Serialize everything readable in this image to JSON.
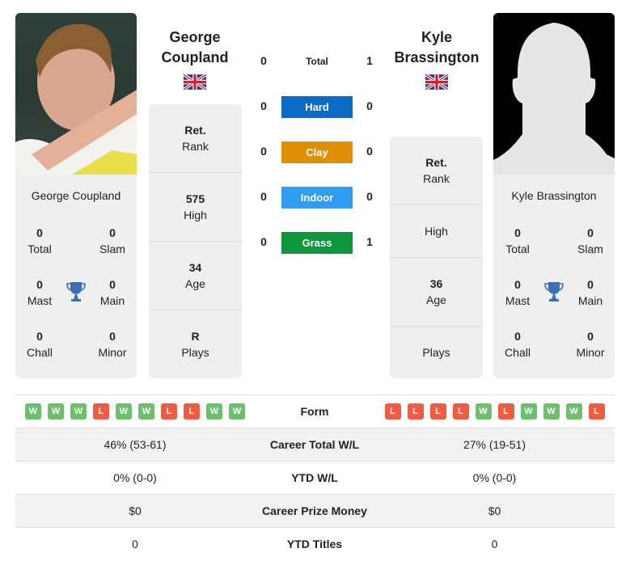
{
  "colors": {
    "hard": "#0a6cc6",
    "clay": "#e08f05",
    "indoor": "#2f9ef2",
    "grass": "#0e973c",
    "win": "#6cbf6c",
    "loss": "#ee5c42",
    "trophy": "#3b6fb6"
  },
  "player1": {
    "name_line1": "George",
    "name_line2": "Coupland",
    "card_name": "George Coupland",
    "flag": "uk-flag",
    "photo": "player-photo",
    "titles": {
      "total": {
        "value": "0",
        "label": "Total"
      },
      "slam": {
        "value": "0",
        "label": "Slam"
      },
      "mast": {
        "value": "0",
        "label": "Mast"
      },
      "main": {
        "value": "0",
        "label": "Main"
      },
      "chall": {
        "value": "0",
        "label": "Chall"
      },
      "minor": {
        "value": "0",
        "label": "Minor"
      }
    },
    "rank": [
      {
        "value": "Ret.",
        "label": "Rank"
      },
      {
        "value": "575",
        "label": "High"
      },
      {
        "value": "34",
        "label": "Age"
      },
      {
        "value": "R",
        "label": "Plays"
      }
    ],
    "form": [
      "W",
      "W",
      "W",
      "L",
      "W",
      "W",
      "L",
      "L",
      "W",
      "W"
    ],
    "career_wl": "46% (53-61)",
    "ytd_wl": "0% (0-0)",
    "prize": "$0",
    "ytd_titles": "0"
  },
  "player2": {
    "name_line1": "Kyle",
    "name_line2": "Brassington",
    "card_name": "Kyle Brassington",
    "flag": "uk-flag",
    "photo": "silhouette-placeholder",
    "titles": {
      "total": {
        "value": "0",
        "label": "Total"
      },
      "slam": {
        "value": "0",
        "label": "Slam"
      },
      "mast": {
        "value": "0",
        "label": "Mast"
      },
      "main": {
        "value": "0",
        "label": "Main"
      },
      "chall": {
        "value": "0",
        "label": "Chall"
      },
      "minor": {
        "value": "0",
        "label": "Minor"
      }
    },
    "rank": [
      {
        "value": "Ret.",
        "label": "Rank"
      },
      {
        "value": "",
        "label": "High"
      },
      {
        "value": "36",
        "label": "Age"
      },
      {
        "value": "",
        "label": "Plays"
      }
    ],
    "form": [
      "L",
      "L",
      "L",
      "L",
      "W",
      "L",
      "W",
      "W",
      "W",
      "L"
    ],
    "career_wl": "27% (19-51)",
    "ytd_wl": "0% (0-0)",
    "prize": "$0",
    "ytd_titles": "0"
  },
  "h2h": [
    {
      "label": "Total",
      "p1": "0",
      "p2": "1",
      "surface": "total"
    },
    {
      "label": "Hard",
      "p1": "0",
      "p2": "0",
      "surface": "hard"
    },
    {
      "label": "Clay",
      "p1": "0",
      "p2": "0",
      "surface": "clay"
    },
    {
      "label": "Indoor",
      "p1": "0",
      "p2": "0",
      "surface": "indoor"
    },
    {
      "label": "Grass",
      "p1": "0",
      "p2": "1",
      "surface": "grass"
    }
  ],
  "table": {
    "form_label": "Form",
    "career_label": "Career Total W/L",
    "ytd_label": "YTD W/L",
    "prize_label": "Career Prize Money",
    "titles_label": "YTD Titles"
  }
}
